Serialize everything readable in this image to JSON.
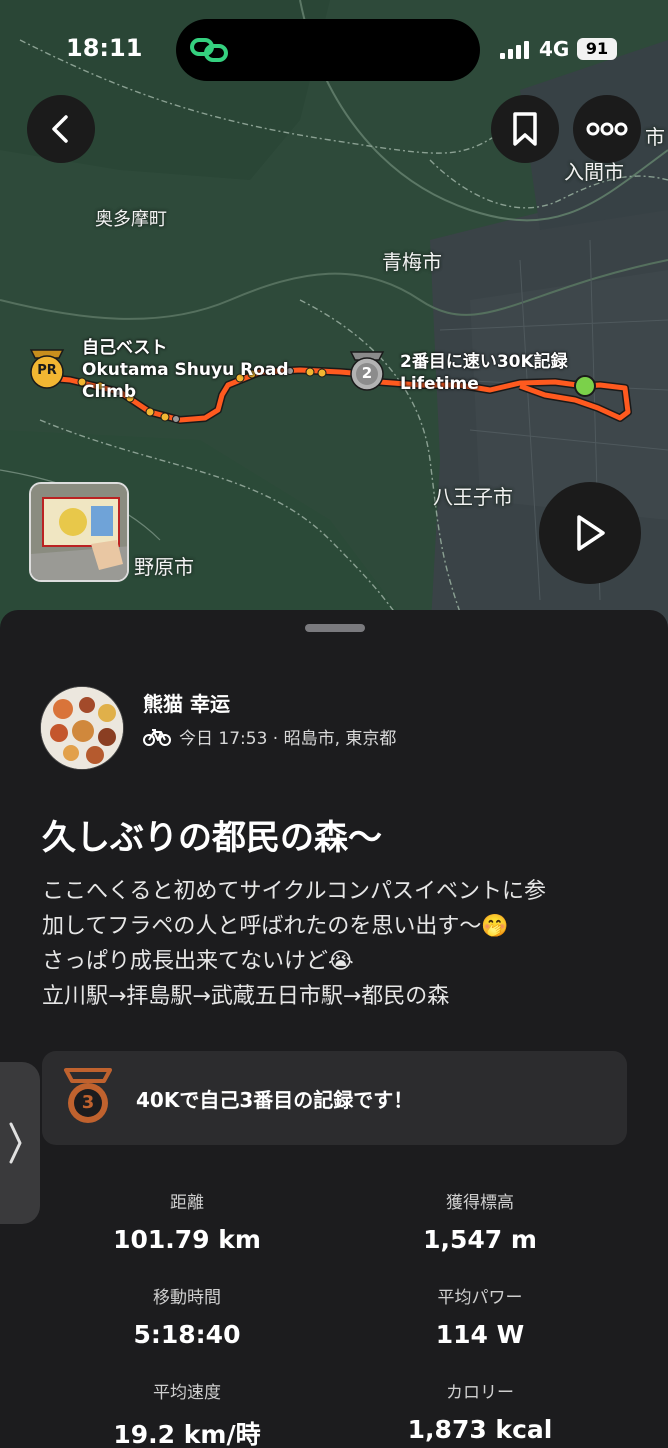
{
  "status_bar": {
    "time": "18:11",
    "network": "4G",
    "battery": "91"
  },
  "map": {
    "places": {
      "okutama": "奥多摩町",
      "ome": "青梅市",
      "iruma": "入間市",
      "hachioji": "八王子市",
      "hinohara": "野原市",
      "fragment": "市"
    },
    "segments": {
      "pr": {
        "badge": "PR",
        "line1": "自己ベスト",
        "line2": "Okutama Shuyu Road",
        "line3": "Climb"
      },
      "second": {
        "badge": "2",
        "line1": "2番目に速い30K記録",
        "line2": "Lifetime"
      }
    },
    "buttons": {
      "back": "back",
      "bookmark": "bookmark",
      "more": "more",
      "play": "play"
    }
  },
  "activity": {
    "athlete_name": "熊猫 幸运",
    "meta": "今日 17:53 · 昭島市, 東京都",
    "title": "久しぶりの都民の森〜",
    "description": [
      "ここへくると初めてサイクルコンパスイベントに参",
      "加してフラペの人と呼ばれたのを思い出す〜🤭",
      "さっぱり成長出来てないけど😭",
      "立川駅→拝島駅→武蔵五日市駅→都民の森"
    ],
    "achievement": {
      "rank": "3",
      "text": "40Kで自己3番目の記録です！"
    },
    "stats": [
      {
        "label": "距離",
        "value": "101.79 km"
      },
      {
        "label": "獲得標高",
        "value": "1,547 m"
      },
      {
        "label": "移動時間",
        "value": "5:18:40"
      },
      {
        "label": "平均パワー",
        "value": "114 W"
      },
      {
        "label": "平均速度",
        "value": "19.2 km/時"
      },
      {
        "label": "カロリー",
        "value": "1,873 kcal"
      }
    ]
  },
  "colors": {
    "route": "#ff5a1f",
    "pr_gold": "#f2b632",
    "start_green": "#7bd14a",
    "medal_bronze": "#c0622e",
    "sheet_bg": "#1c1c1e",
    "card_bg": "#2c2c2e"
  }
}
